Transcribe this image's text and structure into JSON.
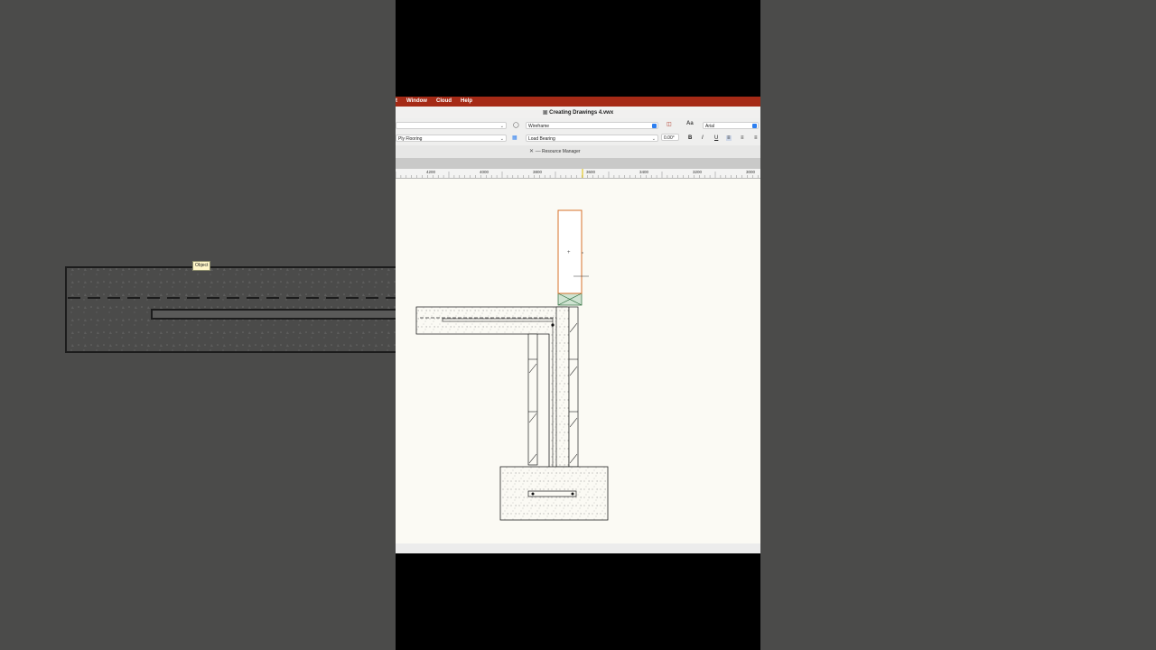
{
  "app": {
    "menu": {
      "partial": "t",
      "window": "Window",
      "cloud": "Cloud",
      "help": "Help"
    },
    "title": "Creating Drawings 4.vwx"
  },
  "toolbar": {
    "row1_left_value": "",
    "row2_left_value": "Ply Flooring",
    "render_mode": "Wireframe",
    "wall_type": "Load Bearing",
    "font": "Arial",
    "rotation": "0.00°",
    "font_icon": "Aa",
    "bold": "B",
    "italic": "I",
    "underline": "U"
  },
  "resource_manager": {
    "label": "Resource Manager"
  },
  "ruler": {
    "ticks": [
      "4200",
      "4000",
      "3800",
      "3600",
      "3400",
      "3200",
      "3000"
    ]
  },
  "canvas": {
    "tooltip": "Object"
  },
  "colors": {
    "menubar": "#a52a16",
    "selection": "#d7712a",
    "canvas": "#fbfaf4"
  }
}
